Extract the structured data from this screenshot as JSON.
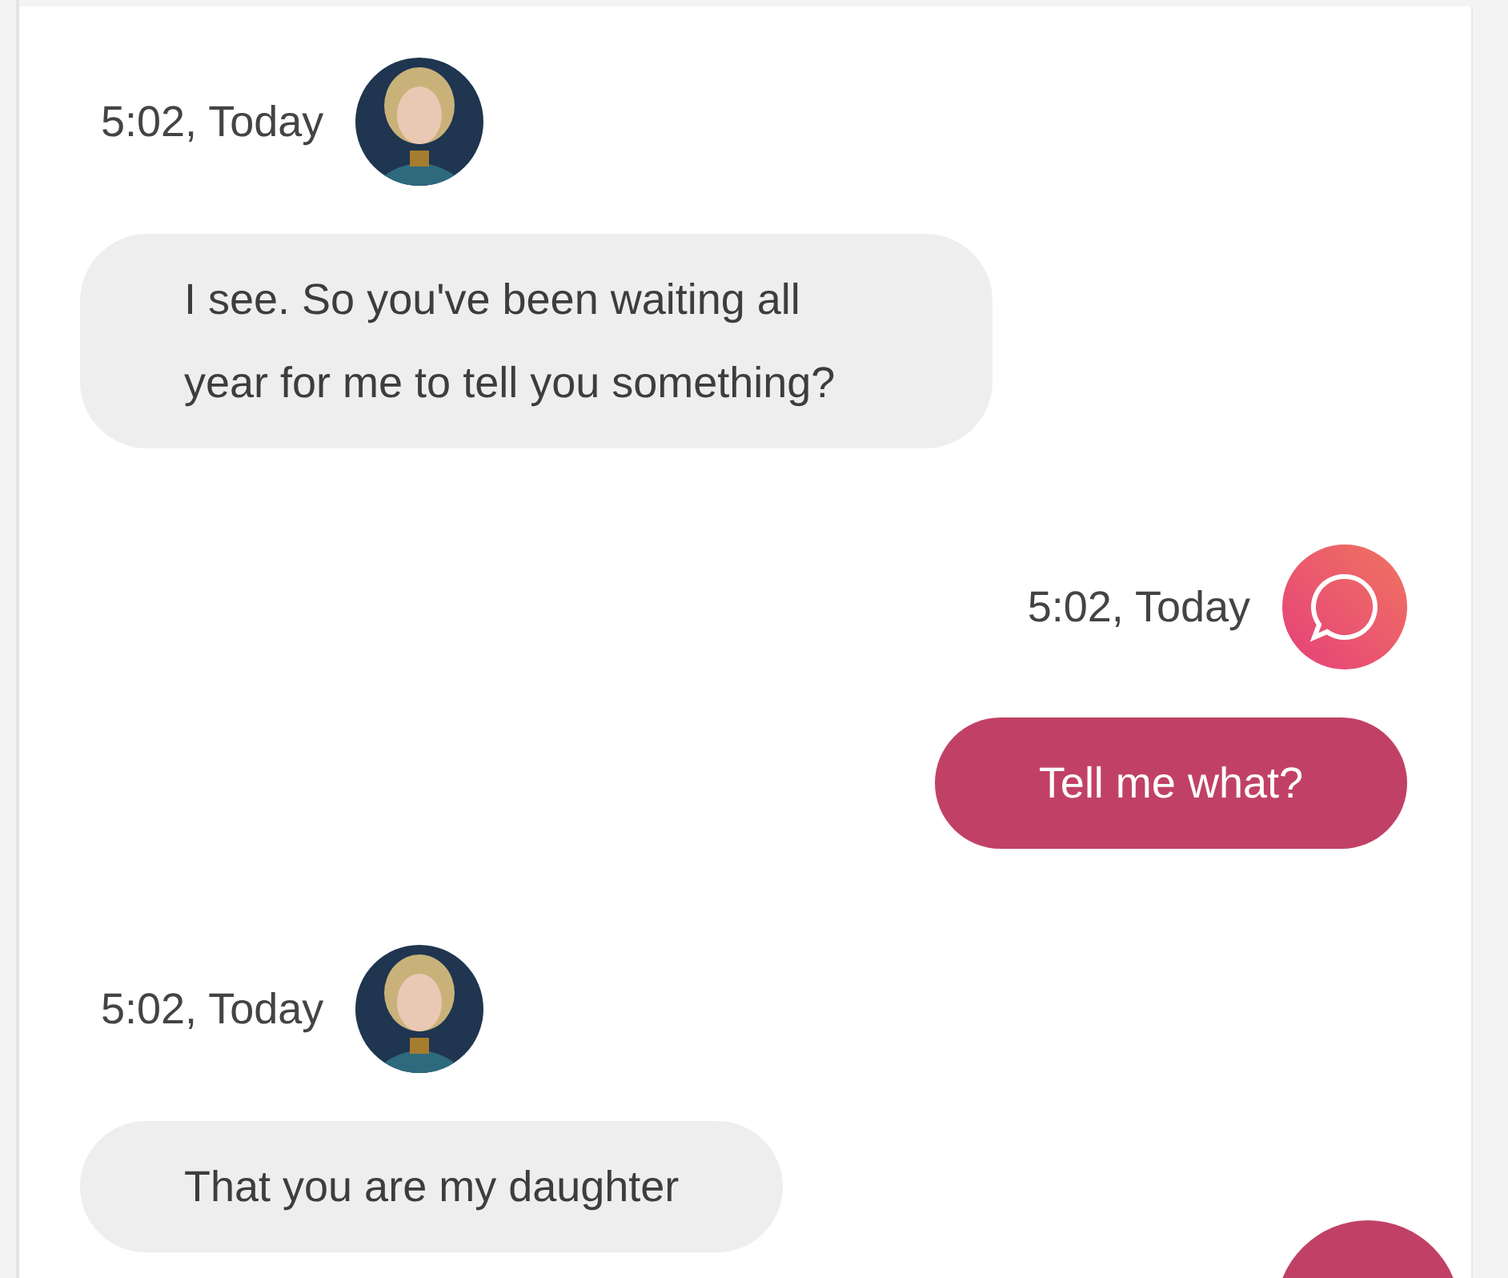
{
  "messages": [
    {
      "kind": "bot",
      "time": "5:02, Today",
      "text": "I see. So you've been waiting all year for me to tell you something?"
    },
    {
      "kind": "user",
      "time": "5:02, Today",
      "text": "Tell me what?"
    },
    {
      "kind": "bot",
      "time": "5:02, Today",
      "text": "That you are my daughter"
    }
  ]
}
